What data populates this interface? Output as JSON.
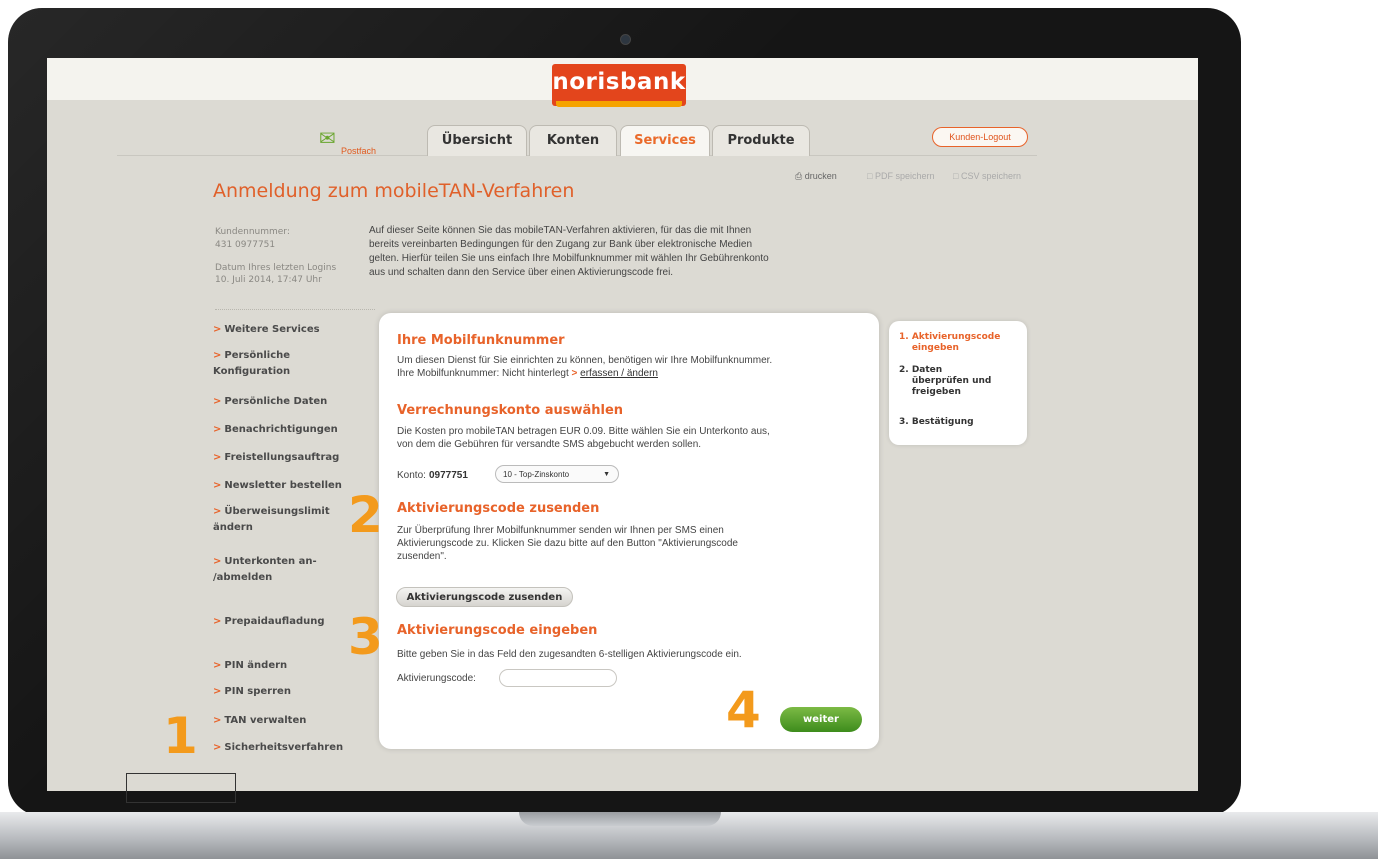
{
  "brand": {
    "logo": "norisbank"
  },
  "header": {
    "postfach": "Postfach",
    "tabs": [
      "Übersicht",
      "Konten",
      "Services",
      "Produkte"
    ],
    "active_tab": "Services",
    "logout": "Kunden-Logout"
  },
  "toolbar": {
    "print": "drucken",
    "pdf": "PDF speichern",
    "csv": "CSV speichern"
  },
  "page": {
    "title": "Anmeldung zum mobileTAN-Verfahren"
  },
  "customer": {
    "number_label": "Kundennummer:",
    "number": "431 0977751",
    "last_login_label": "Datum Ihres letzten Logins",
    "last_login": "10. Juli 2014, 17:47 Uhr"
  },
  "intro_lines": [
    "Auf dieser Seite können Sie das mobileTAN-Verfahren aktivieren, für das die mit Ihnen",
    "bereits vereinbarten Bedingungen für den Zugang zur Bank über elektronische Medien",
    "gelten. Hierfür teilen Sie uns einfach Ihre Mobilfunknummer mit wählen Ihr Gebührenkonto",
    "aus und schalten dann den Service über einen Aktivierungscode frei."
  ],
  "sidebar": {
    "items": [
      "Weitere Services",
      "Persönliche Konfiguration",
      "Persönliche Daten",
      "Benachrichtigungen",
      "Freistellungsauftrag",
      "Newsletter bestellen",
      "Überweisungslimit ändern",
      "Unterkonten an- /abmelden",
      "Prepaidaufladung",
      "PIN ändern",
      "PIN sperren",
      "TAN verwalten",
      "Sicherheitsverfahren"
    ]
  },
  "sections": {
    "mobile": {
      "title": "Ihre Mobilfunknummer",
      "text": "Um diesen Dienst für Sie einrichten zu können, benötigen wir Ihre Mobilfunknummer.",
      "status_prefix": "Ihre Mobilfunknummer: Nicht hinterlegt",
      "link": "erfassen / ändern"
    },
    "account": {
      "title": "Verrechnungskonto auswählen",
      "lines": [
        "Die Kosten pro mobileTAN betragen EUR 0.09. Bitte wählen Sie ein Unterkonto aus,",
        "von dem die Gebühren für versandte SMS abgebucht werden sollen."
      ],
      "konto_label": "Konto:",
      "konto_number": "0977751",
      "select_value": "10 - Top-Zinskonto"
    },
    "send": {
      "title": "Aktivierungscode zusenden",
      "lines": [
        "Zur Überprüfung Ihrer Mobilfunknummer senden wir Ihnen per SMS einen",
        "Aktivierungscode zu. Klicken Sie dazu bitte auf den Button \"Aktivierungscode",
        "zusenden\"."
      ],
      "button": "Aktivierungscode zusenden"
    },
    "enter": {
      "title": "Aktivierungscode eingeben",
      "text": "Bitte geben Sie in das Feld den zugesandten 6-stelligen Aktivierungscode ein.",
      "label": "Aktivierungscode:",
      "value": ""
    }
  },
  "submit": "weiter",
  "steps": [
    {
      "num": "1.",
      "label": "Aktivierungscode eingeben",
      "active": true
    },
    {
      "num": "2.",
      "label": "Daten überprüfen und freigeben",
      "active": false
    },
    {
      "num": "3.",
      "label": "Bestätigung",
      "active": false
    }
  ],
  "callouts": [
    "1",
    "2",
    "3",
    "4"
  ],
  "colors": {
    "brand": "#e3451c",
    "accent": "#e8632a",
    "callout": "#f39a1c",
    "confirm": "#4e9a26"
  }
}
